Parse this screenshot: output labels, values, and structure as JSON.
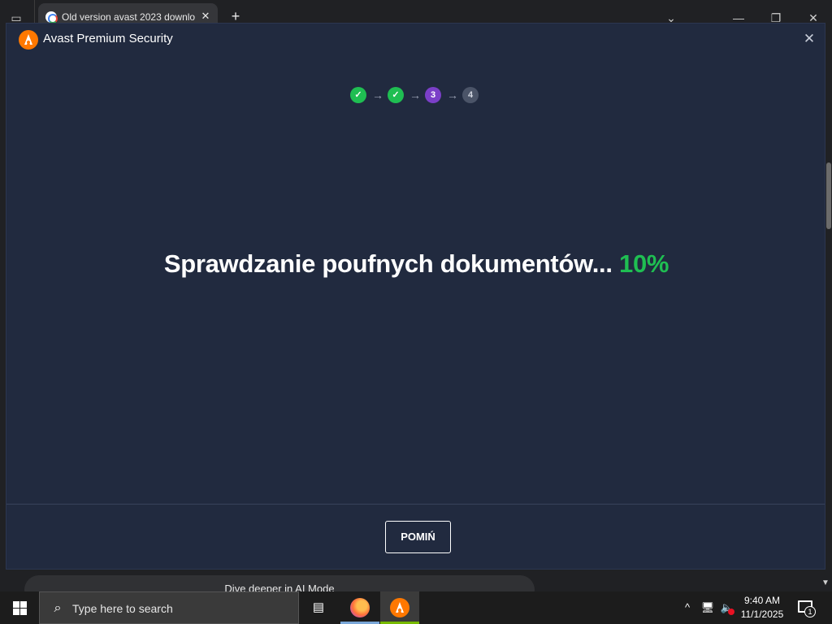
{
  "browser": {
    "tab_title": "Old version avast 2023 downlo",
    "tab_close": "✕",
    "new_tab": "+",
    "tab_search_icon": "tab-search-icon",
    "controls": {
      "dropdown": "⌄",
      "minimize": "—",
      "restore": "❐",
      "close": "✕"
    }
  },
  "background_page": {
    "ai_mode_text": "Dive deeper in AI Mode"
  },
  "avast": {
    "window_title": "Avast Premium Security",
    "close_glyph": "✕",
    "steps": [
      {
        "label": "✓",
        "state": "done"
      },
      {
        "label": "✓",
        "state": "done"
      },
      {
        "label": "3",
        "state": "active"
      },
      {
        "label": "4",
        "state": "pending"
      }
    ],
    "step_arrow": "→",
    "status_text": "Sprawdzanie poufnych dokumentów...",
    "status_percent": "10%",
    "skip_label": "POMIŃ",
    "colors": {
      "background": "#212a3f",
      "accent_green": "#1fbe52",
      "active_step": "#7b3fc8",
      "brand_orange": "#ff7800"
    }
  },
  "taskbar": {
    "search_placeholder": "Type here to search",
    "search_icon": "magnifier-icon",
    "apps": [
      "task-view-icon",
      "firefox-icon",
      "avast-icon"
    ],
    "tray_chevron": "^",
    "clock_time": "9:40 AM",
    "clock_date": "11/1/2025",
    "notification_count": "1"
  }
}
